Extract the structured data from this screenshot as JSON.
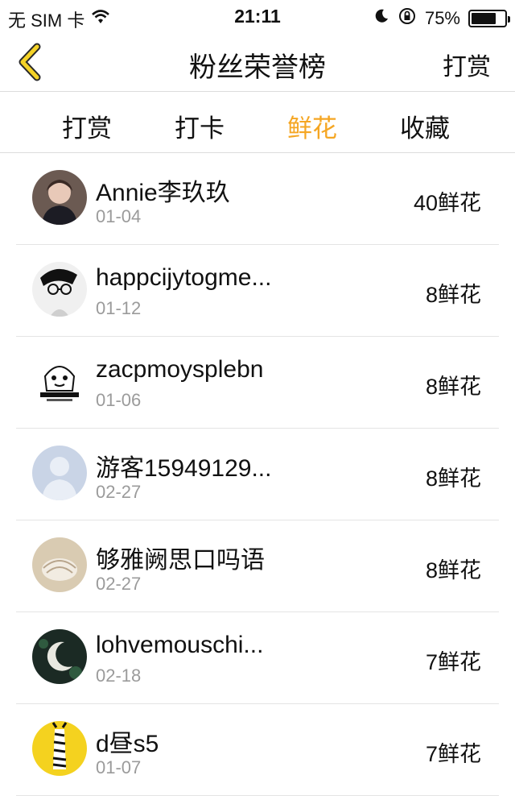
{
  "status_bar": {
    "carrier": "无 SIM 卡",
    "time": "21:11",
    "battery": "75%",
    "battery_level": 0.75
  },
  "nav": {
    "title": "粉丝荣誉榜",
    "right_label": "打赏",
    "back_icon": "chevron-left-icon",
    "accent_color": "#f5d327"
  },
  "tabs": [
    {
      "label": "打赏"
    },
    {
      "label": "打卡"
    },
    {
      "label": "鲜花"
    },
    {
      "label": "收藏"
    }
  ],
  "active_tab_color": "#f5a623",
  "rows": [
    {
      "name": "Annie李玖玖",
      "date": "01-04",
      "amount": "40鲜花"
    },
    {
      "name": "happcijytogme...",
      "date": "01-12",
      "amount": "8鲜花"
    },
    {
      "name": "zacpmoysplebn",
      "date": "01-06",
      "amount": "8鲜花"
    },
    {
      "name": "游客15949129...",
      "date": "02-27",
      "amount": "8鲜花"
    },
    {
      "name": "够雅阙思口吗语",
      "date": "02-27",
      "amount": "8鲜花"
    },
    {
      "name": "lohvemouschi...",
      "date": "02-18",
      "amount": "7鲜花"
    },
    {
      "name": "d昼s5",
      "date": "01-07",
      "amount": "7鲜花"
    }
  ]
}
